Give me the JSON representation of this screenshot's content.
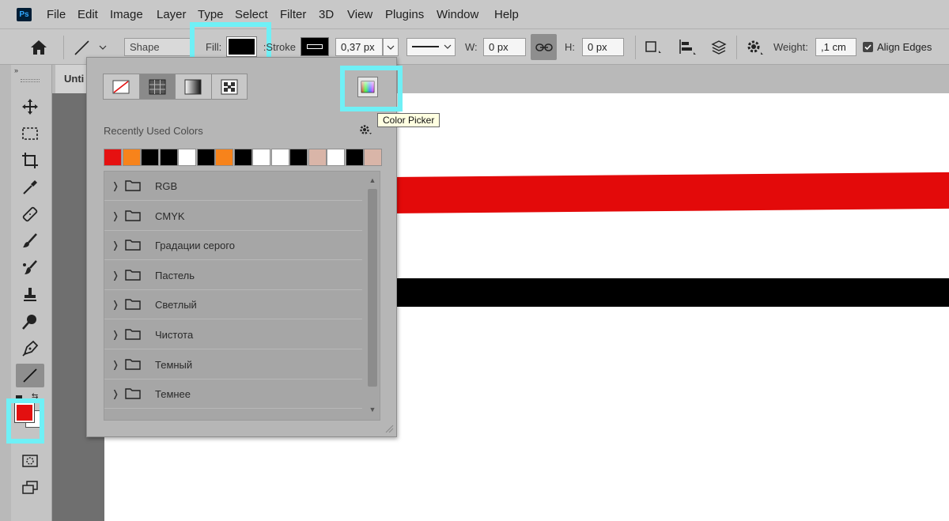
{
  "app": {
    "logo": "Ps"
  },
  "menu": [
    "File",
    "Edit",
    "Image",
    "Layer",
    "Type",
    "Select",
    "Filter",
    "3D",
    "View",
    "Plugins",
    "Window",
    "Help"
  ],
  "options_bar": {
    "mode_value": "Shape",
    "fill_label": "Fill:",
    "fill_color": "#000000",
    "stroke_label": "Stroke:",
    "stroke_width": "0,37 px",
    "w_label": "W:",
    "w_value": "0 px",
    "h_label": "H:",
    "h_value": "0 px",
    "weight_label": "Weight:",
    "weight_value": ",1 cm",
    "align_edges_label": "Align Edges",
    "align_edges_checked": true
  },
  "document": {
    "tab_title": "Unti"
  },
  "colors": {
    "foreground": "#e31010",
    "background": "#ffffff",
    "highlight": "#6ff0f6",
    "red_line": "#e30a0a",
    "black_line": "#000000"
  },
  "swatch_panel": {
    "tooltip": "Color Picker",
    "recent_label": "Recently Used Colors",
    "recent_colors": [
      "#e61111",
      "#f7831b",
      "#000000",
      "#000000",
      "#ffffff",
      "#000000",
      "#f7831b",
      "#000000",
      "#ffffff",
      "#ffffff",
      "#000000",
      "#d9b5a8",
      "#ffffff",
      "#000000",
      "#d9b5a8"
    ],
    "groups": [
      "RGB",
      "CMYK",
      "Градации серого",
      "Пастель",
      "Светлый",
      "Чистота",
      "Темный",
      "Темнее"
    ]
  }
}
